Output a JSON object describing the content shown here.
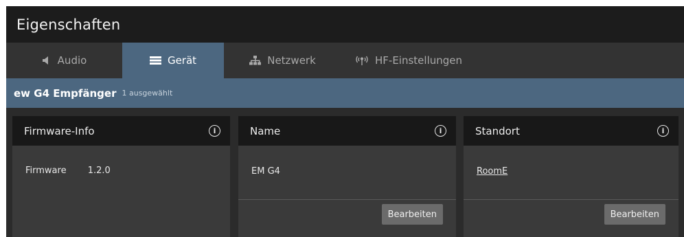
{
  "window": {
    "title": "Eigenschaften"
  },
  "tabs": [
    {
      "label": "Audio",
      "icon": "speaker-icon",
      "active": false
    },
    {
      "label": "Gerät",
      "icon": "device-icon",
      "active": true
    },
    {
      "label": "Netzwerk",
      "icon": "network-icon",
      "active": false
    },
    {
      "label": "HF-Einstellungen",
      "icon": "antenna-icon",
      "active": false
    }
  ],
  "selection": {
    "device": "ew G4 Empfänger",
    "count": "1 ausgewählt"
  },
  "cards": {
    "firmware": {
      "title": "Firmware-Info",
      "label": "Firmware",
      "value": "1.2.0"
    },
    "name": {
      "title": "Name",
      "value": "EM G4",
      "button": "Bearbeiten"
    },
    "location": {
      "title": "Standort",
      "value": "RoomE",
      "button": "Bearbeiten"
    }
  },
  "colors": {
    "accent": "#4c6780",
    "titlebar": "#1c1c1c",
    "tabbar": "#333333",
    "card": "#3a3a3a",
    "card_header": "#181818",
    "button": "#6b6b6b"
  }
}
